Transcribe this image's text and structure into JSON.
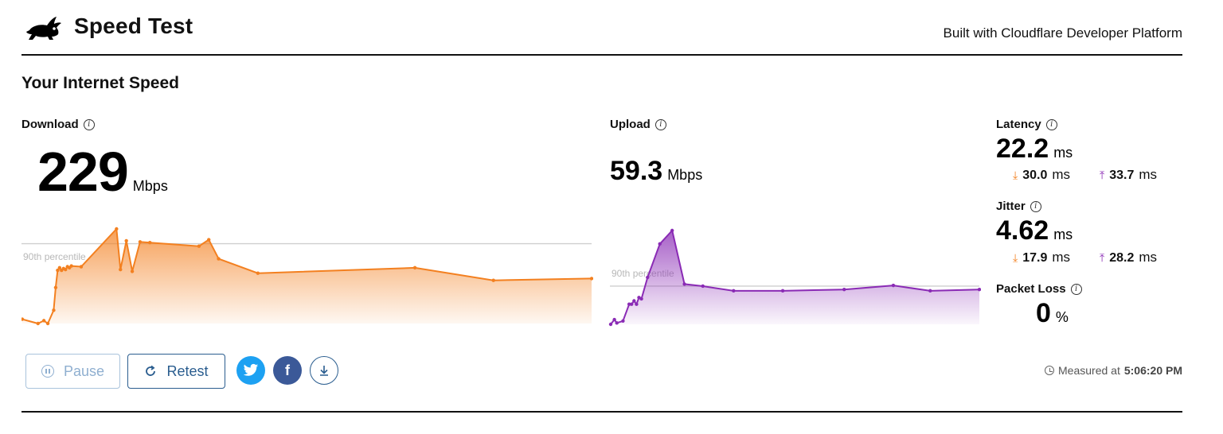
{
  "header": {
    "title": "Speed Test",
    "built_with": "Built with Cloudflare Developer Platform"
  },
  "section_title": "Your Internet Speed",
  "download": {
    "label": "Download",
    "value": "229",
    "unit": "Mbps",
    "percentile_label": "90th percentile",
    "color": "#f38020"
  },
  "upload": {
    "label": "Upload",
    "value": "59.3",
    "unit": "Mbps",
    "percentile_label": "90th percentile",
    "color": "#8a2bb5"
  },
  "latency": {
    "label": "Latency",
    "value": "22.2",
    "unit": "ms",
    "down": "30.0",
    "up": "33.7",
    "sub_unit": "ms"
  },
  "jitter": {
    "label": "Jitter",
    "value": "4.62",
    "unit": "ms",
    "down": "17.9",
    "up": "28.2",
    "sub_unit": "ms"
  },
  "packet_loss": {
    "label": "Packet Loss",
    "value": "0",
    "unit": "%"
  },
  "buttons": {
    "pause": "Pause",
    "retest": "Retest"
  },
  "icons": [
    "rabbit-logo-icon",
    "info-icon",
    "pause-icon",
    "retest-icon",
    "twitter-icon",
    "facebook-icon",
    "download-icon",
    "clock-icon",
    "download-arrow-icon",
    "upload-arrow-icon"
  ],
  "measured": {
    "label": "Measured at",
    "time": "5:06:20 PM"
  },
  "chart_data": [
    {
      "type": "line",
      "name": "download",
      "x": [
        0,
        0.8,
        1.1,
        1.3,
        1.6,
        1.7,
        1.8,
        1.9,
        2.0,
        2.1,
        2.2,
        2.3,
        2.4,
        2.5,
        3.0,
        4.8,
        5.0,
        5.3,
        5.6,
        6.0,
        6.5,
        9.0,
        9.5,
        10.0,
        12.0,
        20.0,
        24.0,
        29.0
      ],
      "y": [
        12,
        0,
        8,
        0,
        37,
        100,
        148,
        155,
        148,
        153,
        150,
        158,
        155,
        160,
        158,
        263,
        150,
        230,
        145,
        227,
        225,
        215,
        233,
        180,
        140,
        155,
        120,
        125
      ],
      "percentile_90": 222
    },
    {
      "type": "line",
      "name": "upload",
      "x": [
        0,
        0.3,
        0.5,
        1.0,
        1.5,
        1.7,
        1.9,
        2.1,
        2.3,
        2.5,
        3.0,
        4.0,
        5.0,
        6.0,
        7.5,
        10,
        14,
        19,
        23,
        26,
        30
      ],
      "y": [
        0,
        7,
        2,
        5,
        30,
        30,
        35,
        30,
        40,
        38,
        70,
        120,
        140,
        60,
        57,
        50,
        50,
        52,
        58,
        50,
        52
      ],
      "percentile_90": 57
    }
  ]
}
